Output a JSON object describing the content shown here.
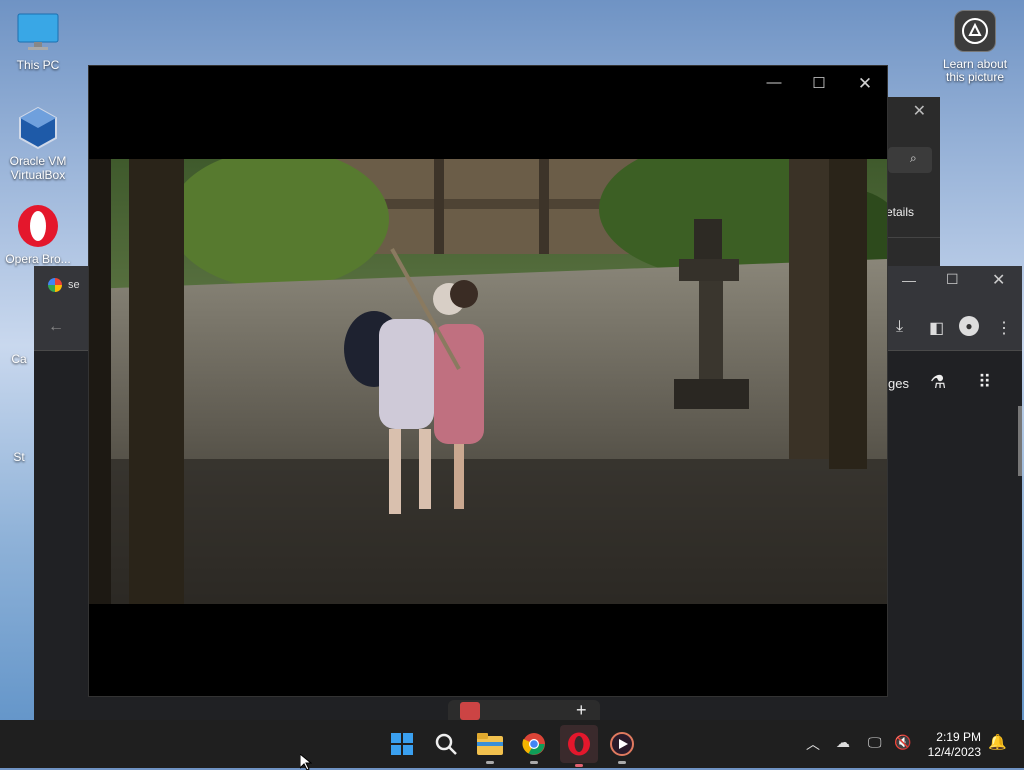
{
  "desktop": {
    "icons": [
      {
        "label": "This PC",
        "icon": "monitor-icon"
      },
      {
        "label": "Oracle VM VirtualBox",
        "icon": "virtualbox-icon"
      },
      {
        "label": "Opera Bro...",
        "icon": "opera-icon"
      }
    ],
    "side_labels": [
      "Ca",
      "St"
    ],
    "spotlight_label": "Learn about this picture"
  },
  "background_window": {
    "details_fragment": "etails"
  },
  "chrome": {
    "tab_fragment": "se",
    "right_fragment": "ges"
  },
  "player": {
    "description_fragment": ""
  },
  "taskbar": {
    "apps": [
      "start-icon",
      "search-icon",
      "file-explorer-icon",
      "chrome-icon",
      "opera-icon",
      "media-player-icon"
    ],
    "time": "2:19 PM",
    "date": "12/4/2023"
  },
  "colors": {
    "taskbar_bg": "#1f1f1f",
    "opera_red": "#e4172c",
    "chrome_bg": "#202124"
  }
}
